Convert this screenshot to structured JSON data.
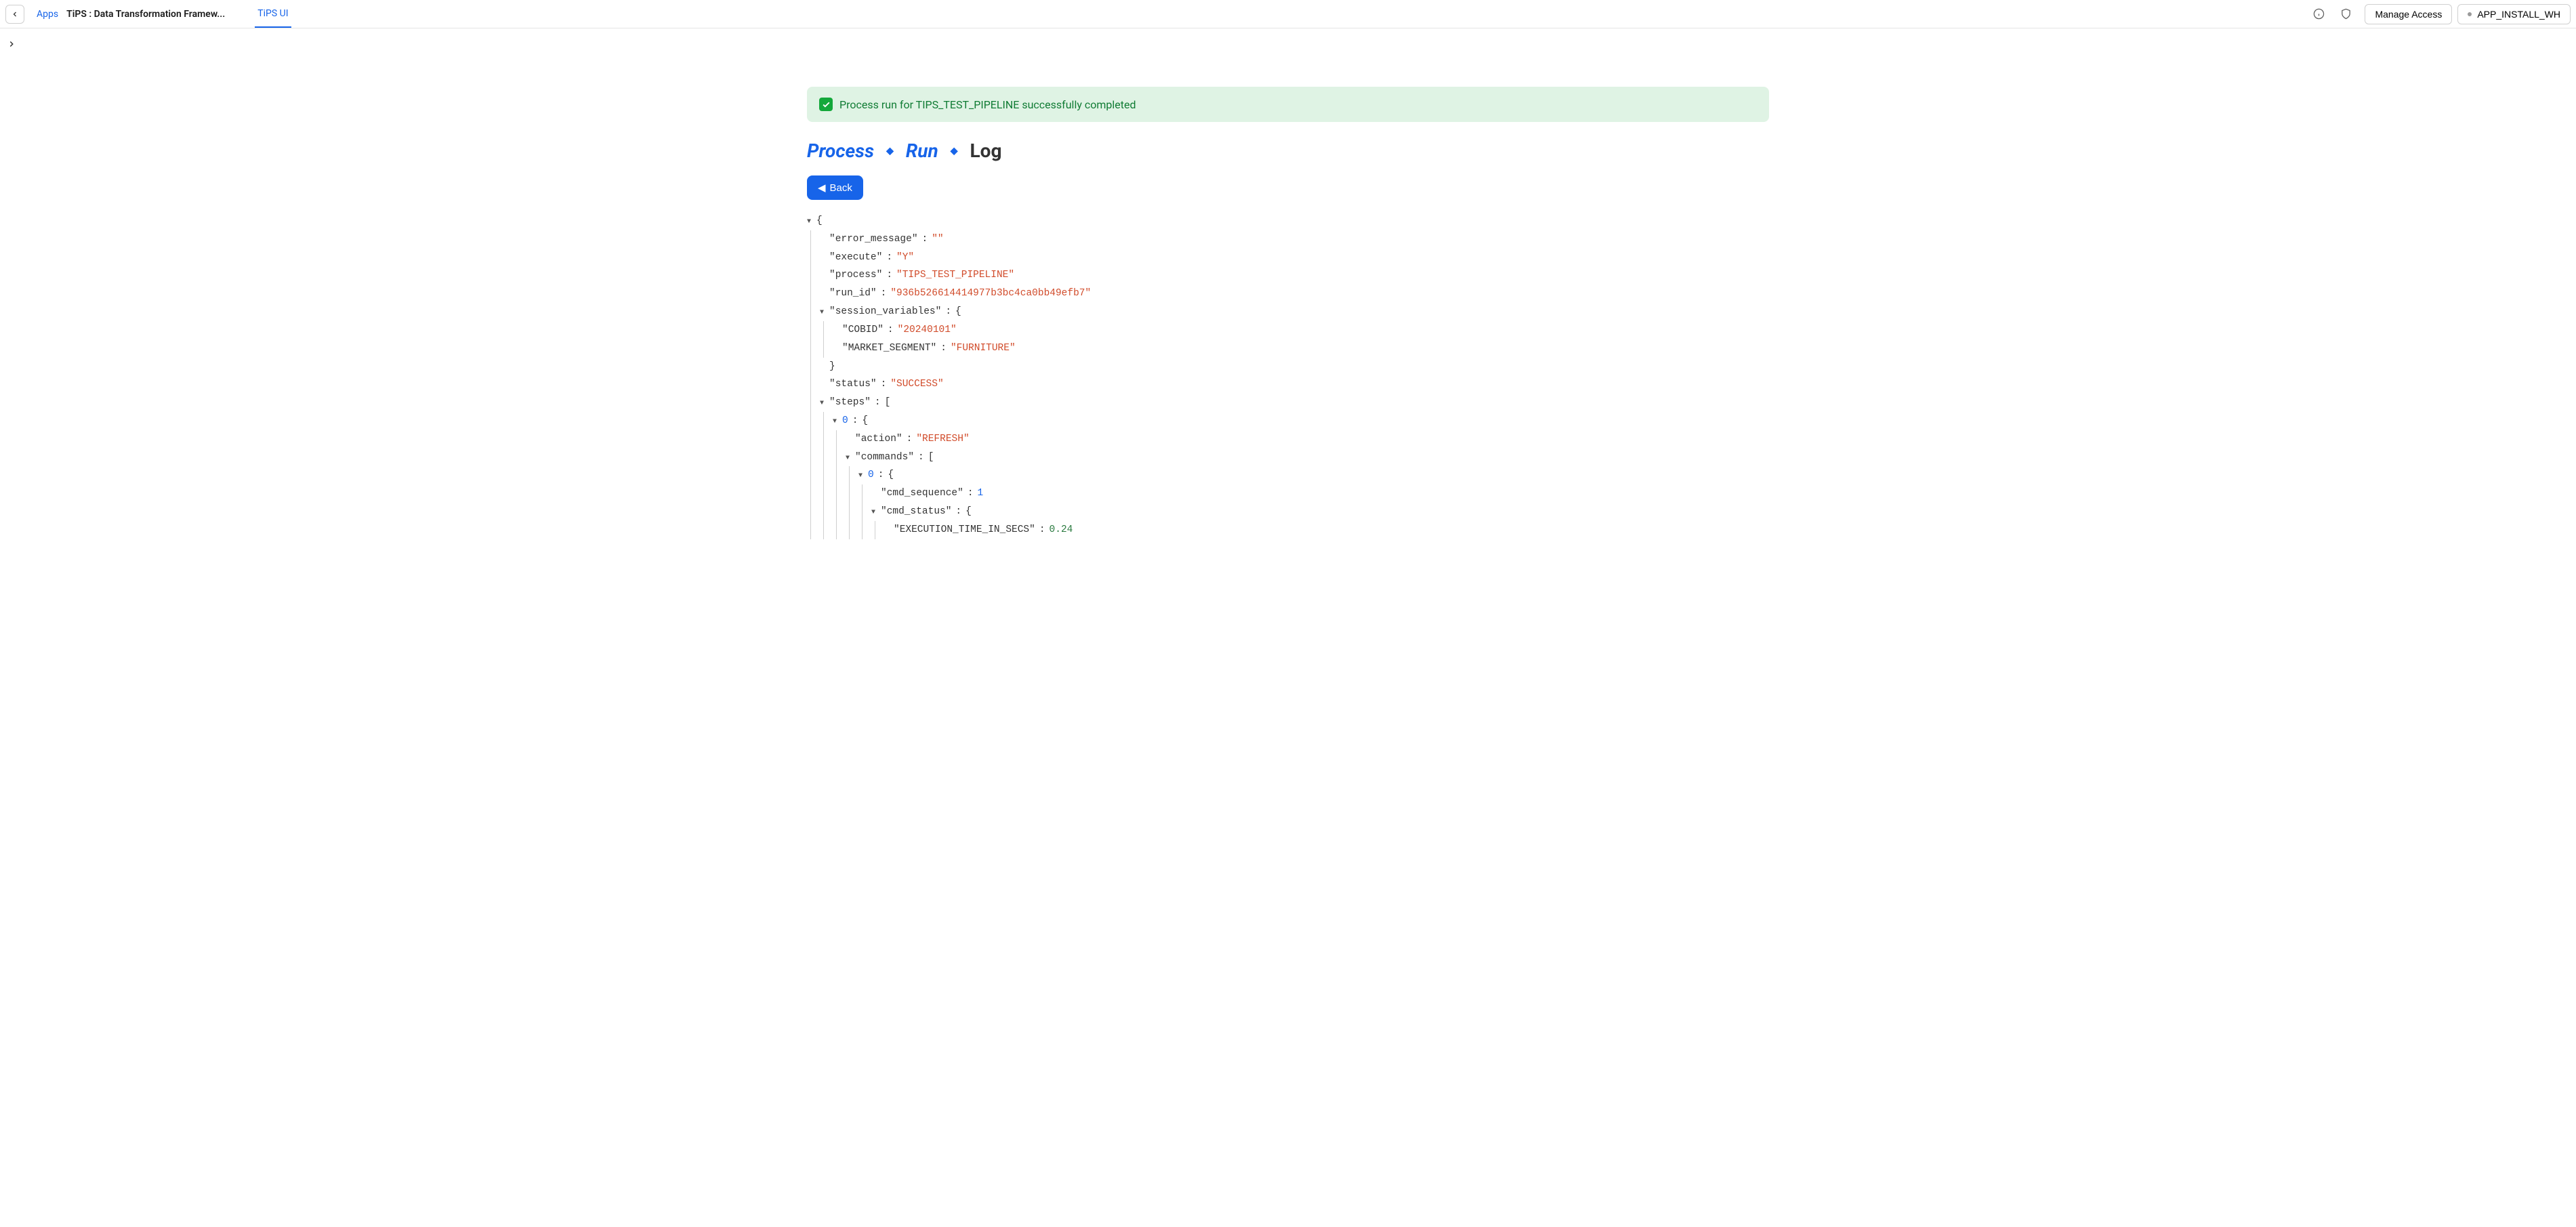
{
  "topbar": {
    "apps_label": "Apps",
    "title": "TiPS : Data Transformation Framew...",
    "tab": "TiPS UI",
    "manage_access": "Manage Access",
    "warehouse": "APP_INSTALL_WH"
  },
  "alert": {
    "text": "Process run for TIPS_TEST_PIPELINE successfully completed"
  },
  "crumbs": {
    "process": "Process",
    "run": "Run",
    "log": "Log"
  },
  "buttons": {
    "back": "Back"
  },
  "log": {
    "error_message_key": "\"error_message\"",
    "error_message_val": "\"\"",
    "execute_key": "\"execute\"",
    "execute_val": "\"Y\"",
    "process_key": "\"process\"",
    "process_val": "\"TIPS_TEST_PIPELINE\"",
    "run_id_key": "\"run_id\"",
    "run_id_val": "\"936b526614414977b3bc4ca0bb49efb7\"",
    "session_variables_key": "\"session_variables\"",
    "cobid_key": "\"COBID\"",
    "cobid_val": "\"20240101\"",
    "market_segment_key": "\"MARKET_SEGMENT\"",
    "market_segment_val": "\"FURNITURE\"",
    "status_key": "\"status\"",
    "status_val": "\"SUCCESS\"",
    "steps_key": "\"steps\"",
    "idx0": "0",
    "action_key": "\"action\"",
    "action_val": "\"REFRESH\"",
    "commands_key": "\"commands\"",
    "cmd_sequence_key": "\"cmd_sequence\"",
    "cmd_sequence_val": "1",
    "cmd_status_key": "\"cmd_status\"",
    "exec_time_key": "\"EXECUTION_TIME_IN_SECS\"",
    "exec_time_val": "0.24"
  }
}
